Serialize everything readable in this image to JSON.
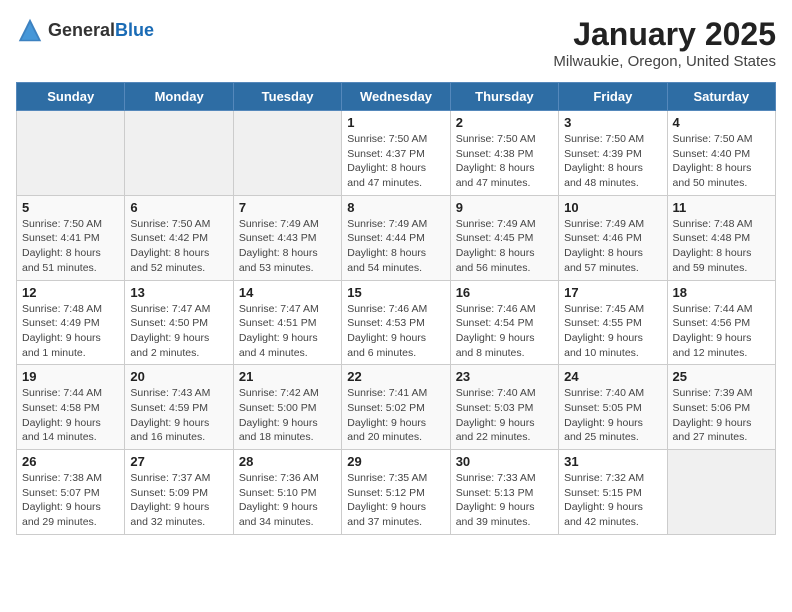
{
  "header": {
    "logo_general": "General",
    "logo_blue": "Blue",
    "month": "January 2025",
    "location": "Milwaukie, Oregon, United States"
  },
  "weekdays": [
    "Sunday",
    "Monday",
    "Tuesday",
    "Wednesday",
    "Thursday",
    "Friday",
    "Saturday"
  ],
  "weeks": [
    [
      {
        "day": "",
        "info": ""
      },
      {
        "day": "",
        "info": ""
      },
      {
        "day": "",
        "info": ""
      },
      {
        "day": "1",
        "info": "Sunrise: 7:50 AM\nSunset: 4:37 PM\nDaylight: 8 hours and 47 minutes."
      },
      {
        "day": "2",
        "info": "Sunrise: 7:50 AM\nSunset: 4:38 PM\nDaylight: 8 hours and 47 minutes."
      },
      {
        "day": "3",
        "info": "Sunrise: 7:50 AM\nSunset: 4:39 PM\nDaylight: 8 hours and 48 minutes."
      },
      {
        "day": "4",
        "info": "Sunrise: 7:50 AM\nSunset: 4:40 PM\nDaylight: 8 hours and 50 minutes."
      }
    ],
    [
      {
        "day": "5",
        "info": "Sunrise: 7:50 AM\nSunset: 4:41 PM\nDaylight: 8 hours and 51 minutes."
      },
      {
        "day": "6",
        "info": "Sunrise: 7:50 AM\nSunset: 4:42 PM\nDaylight: 8 hours and 52 minutes."
      },
      {
        "day": "7",
        "info": "Sunrise: 7:49 AM\nSunset: 4:43 PM\nDaylight: 8 hours and 53 minutes."
      },
      {
        "day": "8",
        "info": "Sunrise: 7:49 AM\nSunset: 4:44 PM\nDaylight: 8 hours and 54 minutes."
      },
      {
        "day": "9",
        "info": "Sunrise: 7:49 AM\nSunset: 4:45 PM\nDaylight: 8 hours and 56 minutes."
      },
      {
        "day": "10",
        "info": "Sunrise: 7:49 AM\nSunset: 4:46 PM\nDaylight: 8 hours and 57 minutes."
      },
      {
        "day": "11",
        "info": "Sunrise: 7:48 AM\nSunset: 4:48 PM\nDaylight: 8 hours and 59 minutes."
      }
    ],
    [
      {
        "day": "12",
        "info": "Sunrise: 7:48 AM\nSunset: 4:49 PM\nDaylight: 9 hours and 1 minute."
      },
      {
        "day": "13",
        "info": "Sunrise: 7:47 AM\nSunset: 4:50 PM\nDaylight: 9 hours and 2 minutes."
      },
      {
        "day": "14",
        "info": "Sunrise: 7:47 AM\nSunset: 4:51 PM\nDaylight: 9 hours and 4 minutes."
      },
      {
        "day": "15",
        "info": "Sunrise: 7:46 AM\nSunset: 4:53 PM\nDaylight: 9 hours and 6 minutes."
      },
      {
        "day": "16",
        "info": "Sunrise: 7:46 AM\nSunset: 4:54 PM\nDaylight: 9 hours and 8 minutes."
      },
      {
        "day": "17",
        "info": "Sunrise: 7:45 AM\nSunset: 4:55 PM\nDaylight: 9 hours and 10 minutes."
      },
      {
        "day": "18",
        "info": "Sunrise: 7:44 AM\nSunset: 4:56 PM\nDaylight: 9 hours and 12 minutes."
      }
    ],
    [
      {
        "day": "19",
        "info": "Sunrise: 7:44 AM\nSunset: 4:58 PM\nDaylight: 9 hours and 14 minutes."
      },
      {
        "day": "20",
        "info": "Sunrise: 7:43 AM\nSunset: 4:59 PM\nDaylight: 9 hours and 16 minutes."
      },
      {
        "day": "21",
        "info": "Sunrise: 7:42 AM\nSunset: 5:00 PM\nDaylight: 9 hours and 18 minutes."
      },
      {
        "day": "22",
        "info": "Sunrise: 7:41 AM\nSunset: 5:02 PM\nDaylight: 9 hours and 20 minutes."
      },
      {
        "day": "23",
        "info": "Sunrise: 7:40 AM\nSunset: 5:03 PM\nDaylight: 9 hours and 22 minutes."
      },
      {
        "day": "24",
        "info": "Sunrise: 7:40 AM\nSunset: 5:05 PM\nDaylight: 9 hours and 25 minutes."
      },
      {
        "day": "25",
        "info": "Sunrise: 7:39 AM\nSunset: 5:06 PM\nDaylight: 9 hours and 27 minutes."
      }
    ],
    [
      {
        "day": "26",
        "info": "Sunrise: 7:38 AM\nSunset: 5:07 PM\nDaylight: 9 hours and 29 minutes."
      },
      {
        "day": "27",
        "info": "Sunrise: 7:37 AM\nSunset: 5:09 PM\nDaylight: 9 hours and 32 minutes."
      },
      {
        "day": "28",
        "info": "Sunrise: 7:36 AM\nSunset: 5:10 PM\nDaylight: 9 hours and 34 minutes."
      },
      {
        "day": "29",
        "info": "Sunrise: 7:35 AM\nSunset: 5:12 PM\nDaylight: 9 hours and 37 minutes."
      },
      {
        "day": "30",
        "info": "Sunrise: 7:33 AM\nSunset: 5:13 PM\nDaylight: 9 hours and 39 minutes."
      },
      {
        "day": "31",
        "info": "Sunrise: 7:32 AM\nSunset: 5:15 PM\nDaylight: 9 hours and 42 minutes."
      },
      {
        "day": "",
        "info": ""
      }
    ]
  ]
}
